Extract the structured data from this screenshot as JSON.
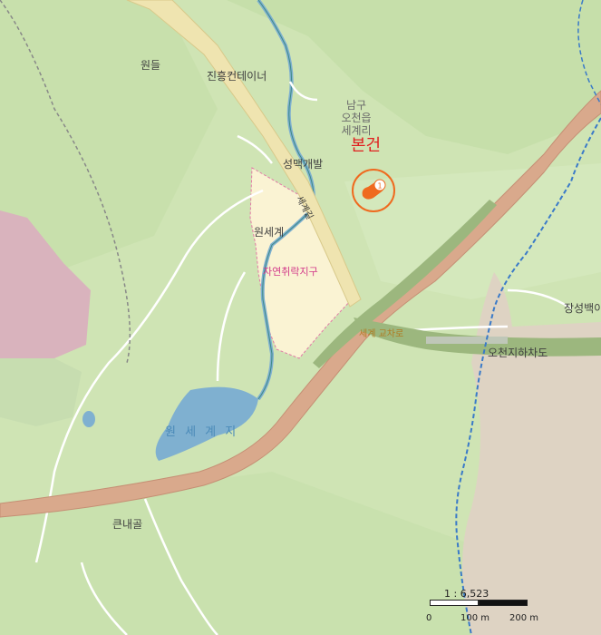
{
  "map": {
    "labels": {
      "wondeul": "원들",
      "jinheung_container": "진흥컨테이너",
      "namgu_1": "남구",
      "namgu_2": "오천읍",
      "namgu_3": "세계리",
      "bongeon": "본건",
      "seongmaek": "성맥개발",
      "road_vertical": "세계길",
      "wonsegye": "원세계",
      "natural_zone": "자연취락지구",
      "interchange": "세계 교차로",
      "ocheon_underpass": "오천지하차도",
      "jangseong": "장성백이",
      "wonsegye_ji": "원 세 계 지",
      "keunnaegol": "큰내골"
    },
    "marker": {
      "number": "1"
    },
    "scale": {
      "ratio": "1 : 6,523",
      "ticks": [
        "0",
        "100 m",
        "200 m"
      ]
    },
    "colors": {
      "background": "#cfe4b4",
      "marker": "#ef6a1f",
      "bongeon_text": "#e02020",
      "highway": "#d9a98c",
      "zone_fill": "#faf3d3",
      "zone_text": "#d23a8a",
      "water": "#7fb0d0"
    }
  }
}
